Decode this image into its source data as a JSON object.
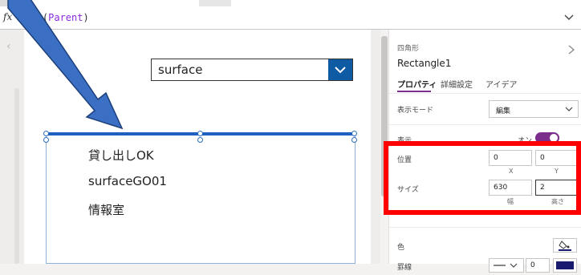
{
  "formula_bar": {
    "fx_label": "fx",
    "formula_prefix": "lect(",
    "formula_identifier": "Parent",
    "formula_suffix": ")"
  },
  "canvas": {
    "dropdown_value": "surface",
    "list_items": [
      "貸し出しOK",
      "surfaceGO01",
      "情報室"
    ]
  },
  "panel": {
    "control_type": "四角形",
    "control_name": "Rectangle1",
    "tabs": [
      "プロパティ",
      "詳細設定",
      "アイデア"
    ],
    "display_mode_label": "表示モード",
    "display_mode_value": "編集",
    "visible_label": "表示",
    "visible_toggle_text": "オン",
    "position_label": "位置",
    "position_x": "0",
    "position_y": "0",
    "x_caption": "X",
    "y_caption": "Y",
    "size_label": "サイズ",
    "size_width": "630",
    "size_height": "2",
    "width_caption": "幅",
    "height_caption": "高さ",
    "color_label": "色",
    "border_label": "罫線",
    "border_width": "0"
  },
  "colors": {
    "accent_purple": "#7b2e8c",
    "highlight_red": "#ff0000",
    "dropdown_blue": "#0e5ba3",
    "arrow_blue": "#3b6fc4",
    "border_color": "#1a1a6e"
  }
}
